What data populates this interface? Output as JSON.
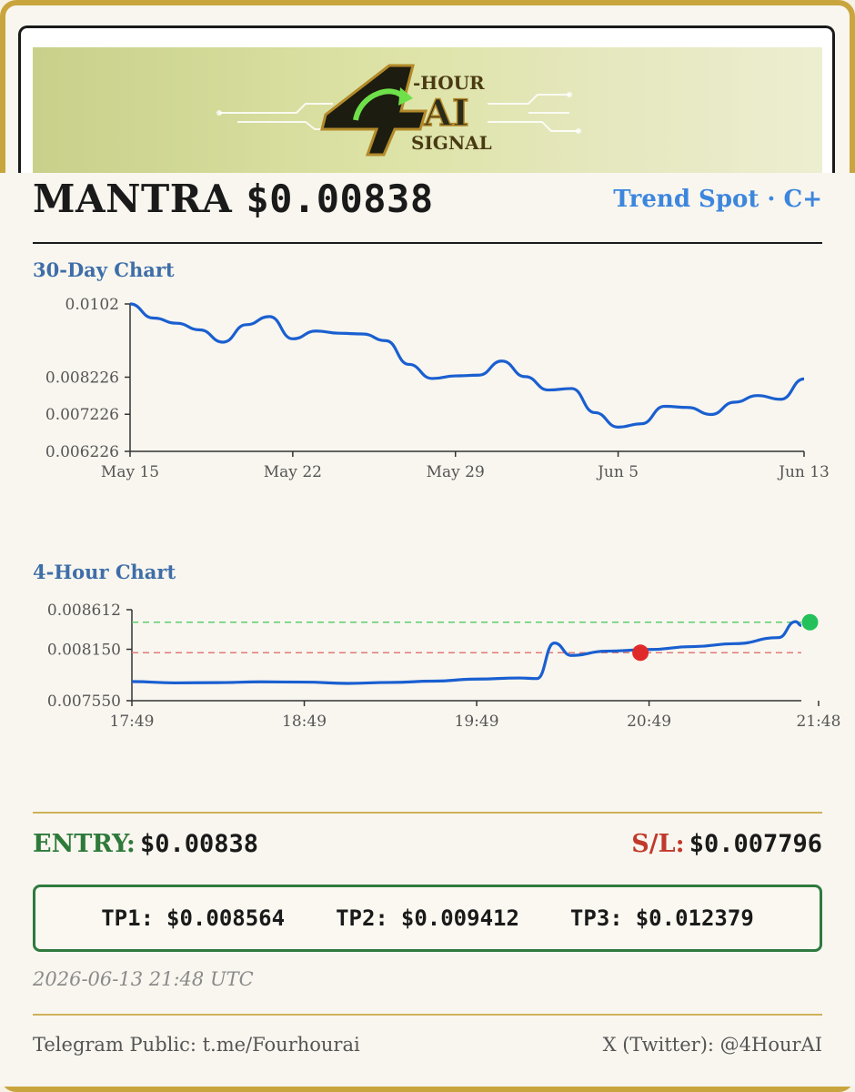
{
  "banner": {
    "logo_numeral": "4",
    "logo_line1": "-HOUR",
    "logo_line2": "AI",
    "logo_line3": "SIGNAL"
  },
  "header": {
    "asset": "MANTRA",
    "price": "$0.00838",
    "grade": "Trend Spot · C+"
  },
  "chart_data": [
    {
      "type": "line",
      "title": "30-Day Chart",
      "x": [
        "May 15",
        "May 16",
        "May 17",
        "May 18",
        "May 19",
        "May 20",
        "May 21",
        "May 22",
        "May 23",
        "May 24",
        "May 25",
        "May 26",
        "May 27",
        "May 28",
        "May 29",
        "May 30",
        "May 31",
        "Jun 1",
        "Jun 2",
        "Jun 3",
        "Jun 4",
        "Jun 5",
        "Jun 6",
        "Jun 7",
        "Jun 8",
        "Jun 9",
        "Jun 10",
        "Jun 11",
        "Jun 12",
        "Jun 13"
      ],
      "series": [
        {
          "values": [
            0.0102,
            0.00982,
            0.00968,
            0.0095,
            0.00917,
            0.00964,
            0.00986,
            0.00926,
            0.00947,
            0.00941,
            0.00939,
            0.00921,
            0.00857,
            0.00819,
            0.00826,
            0.00828,
            0.00866,
            0.00824,
            0.00788,
            0.00792,
            0.00727,
            0.00688,
            0.00697,
            0.00744,
            0.00741,
            0.00722,
            0.00755,
            0.00773,
            0.00763,
            0.00818
          ],
          "color": "#1a5fd0"
        }
      ],
      "x_ticks": [
        "May 15",
        "May 22",
        "May 29",
        "Jun 5",
        "Jun 13"
      ],
      "y_ticks": [
        "0.0102",
        "0.008226",
        "0.007226",
        "0.006226"
      ],
      "ylim": [
        0.006226,
        0.0102
      ],
      "grid": false
    },
    {
      "type": "line",
      "title": "4-Hour Chart",
      "x": [
        "17:49",
        "18:04",
        "18:19",
        "18:34",
        "18:49",
        "19:04",
        "19:19",
        "19:34",
        "19:49",
        "20:04",
        "20:10",
        "20:16",
        "20:22",
        "20:34",
        "20:49",
        "21:04",
        "21:19",
        "21:34",
        "21:40",
        "21:42"
      ],
      "series": [
        {
          "values": [
            0.007773,
            0.007758,
            0.007761,
            0.00777,
            0.007767,
            0.007752,
            0.007763,
            0.007778,
            0.007802,
            0.007815,
            0.007808,
            0.008223,
            0.008078,
            0.008128,
            0.008147,
            0.008181,
            0.008216,
            0.008286,
            0.008473,
            0.008428
          ],
          "color": "#1a5fd0"
        }
      ],
      "x_ticks": [
        "17:49",
        "18:49",
        "19:49",
        "20:49",
        "21:48"
      ],
      "y_ticks": [
        "0.008612",
        "0.008150",
        "0.007550"
      ],
      "ylim": [
        0.00755,
        0.008612
      ],
      "reference_lines": [
        {
          "value": 0.008466,
          "color": "#5ccd6e",
          "style": "dashed"
        },
        {
          "value": 0.00811,
          "color": "#e07a78",
          "style": "dashed"
        }
      ],
      "markers": [
        {
          "x": "20:46",
          "value": 0.00811,
          "color": "#e02a2a"
        },
        {
          "x": "21:45",
          "value": 0.008466,
          "color": "#24c15a"
        }
      ],
      "grid": false
    }
  ],
  "trade": {
    "entry_label": "ENTRY:",
    "entry_value": "$0.00838",
    "stop_label": "S/L:",
    "stop_value": "$0.007796",
    "tp1_label": "TP1:",
    "tp1_value": "$0.008564",
    "tp2_label": "TP2:",
    "tp2_value": "$0.009412",
    "tp3_label": "TP3:",
    "tp3_value": "$0.012379"
  },
  "timestamp": "2026-06-13 21:48 UTC",
  "footer": {
    "telegram": "Telegram Public: t.me/Fourhourai",
    "twitter": "X (Twitter): @4HourAI"
  }
}
